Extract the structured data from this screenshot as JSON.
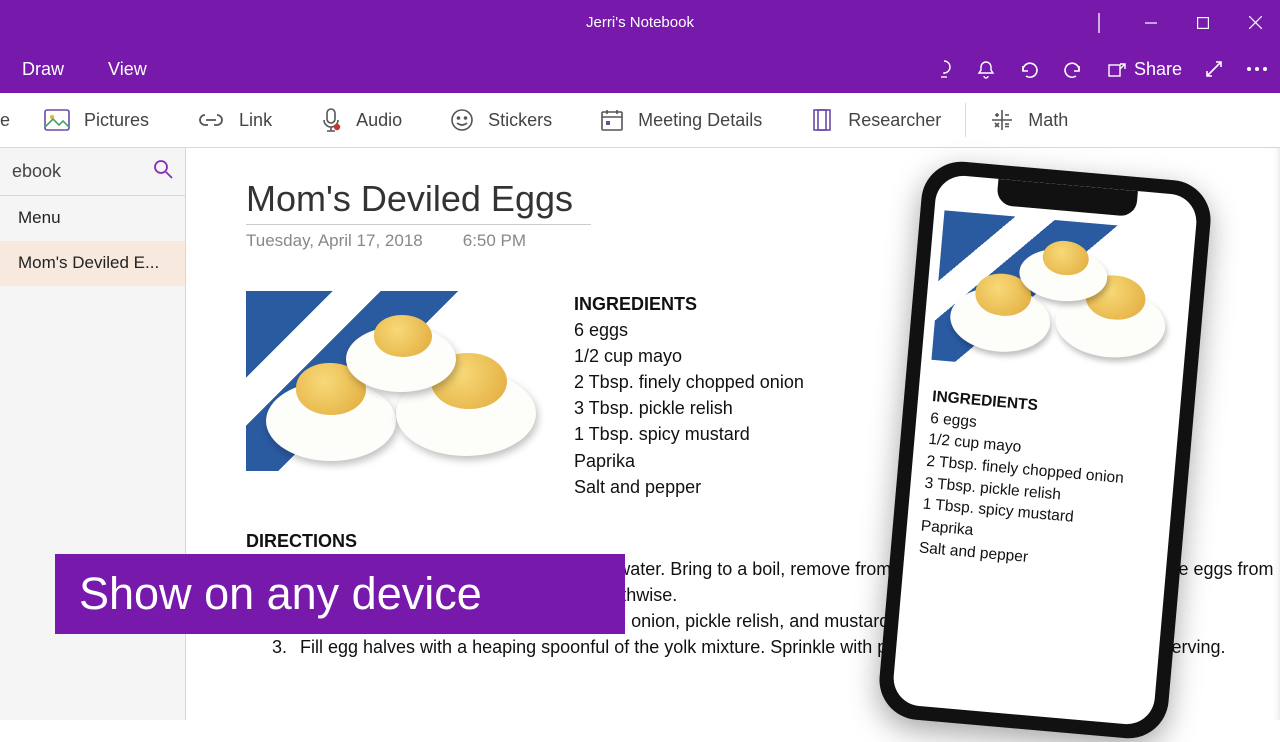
{
  "titlebar": {
    "title": "Jerri's Notebook"
  },
  "menubar": {
    "tabs": [
      "Draw",
      "View"
    ],
    "share": "Share"
  },
  "ribbon": {
    "items": [
      {
        "icon": "table",
        "label": "e"
      },
      {
        "icon": "pictures",
        "label": "Pictures"
      },
      {
        "icon": "link",
        "label": "Link"
      },
      {
        "icon": "audio",
        "label": "Audio"
      },
      {
        "icon": "stickers",
        "label": "Stickers"
      },
      {
        "icon": "meeting",
        "label": "Meeting Details"
      },
      {
        "icon": "researcher",
        "label": "Researcher"
      },
      {
        "icon": "math",
        "label": "Math"
      }
    ]
  },
  "sidebar": {
    "notebook_label": "ebook",
    "pages": [
      {
        "label": "Menu",
        "selected": false
      },
      {
        "label": "Mom's Deviled E...",
        "selected": true
      }
    ]
  },
  "page": {
    "title": "Mom's Deviled Eggs",
    "date": "Tuesday, April 17, 2018",
    "time": "6:50 PM",
    "ingredients_header": "INGREDIENTS",
    "ingredients": [
      "6 eggs",
      "1/2 cup mayo",
      "2 Tbsp. finely chopped onion",
      "3 Tbsp. pickle relish",
      "1 Tbsp. spicy mustard",
      "Paprika",
      "Salt and pepper"
    ],
    "directions_header": "DIRECTIONS",
    "directions": [
      "Place eggs in a pot and cover with cold water. Bring to a boil, remove from heat, and let sit 10 minutes. Remove eggs from hot water, cool, peel, and cut in half lengthwise.",
      "Remove yolks and mash; mix with mayo, onion, pickle relish, and mustard.",
      "Fill egg halves with a heaping spoonful of the yolk mixture. Sprinkle with paprika, salt, and pepper. Chill until serving."
    ]
  },
  "banner": {
    "text": "Show on any device"
  },
  "phone": {
    "ingredients_header": "INGREDIENTS",
    "ingredients": [
      "6 eggs",
      "1/2 cup mayo",
      "2 Tbsp. finely chopped onion",
      "3 Tbsp. pickle relish",
      "1 Tbsp. spicy mustard",
      "Paprika",
      "Salt and pepper"
    ]
  }
}
